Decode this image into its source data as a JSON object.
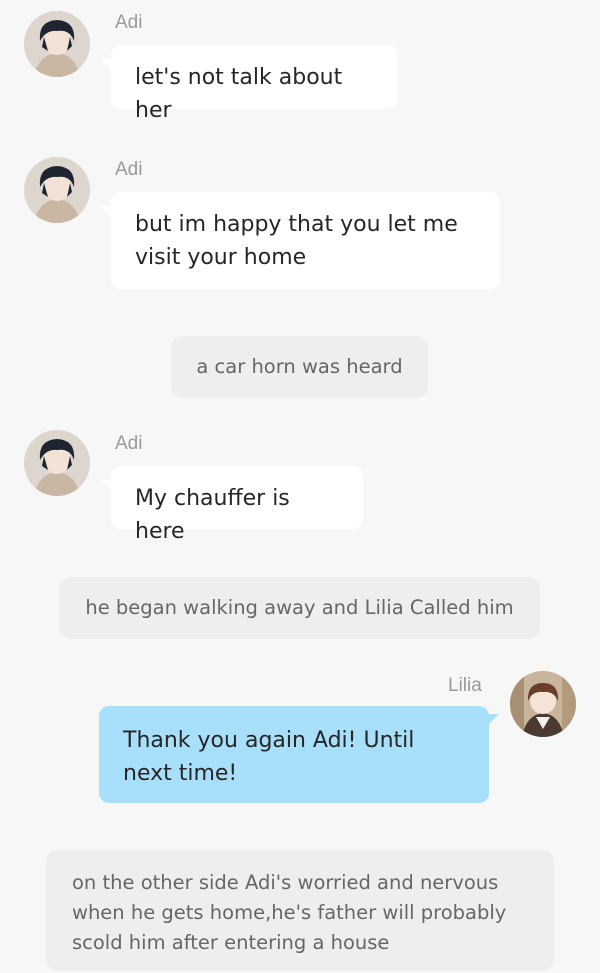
{
  "messages": [
    {
      "type": "left",
      "sender": "Adi",
      "avatar": "adi-avatar",
      "text": "let's not talk about her"
    },
    {
      "type": "left",
      "sender": "Adi",
      "avatar": "adi-avatar",
      "text": "but im happy that you let me visit your home"
    },
    {
      "type": "narration",
      "text": "a car horn was heard"
    },
    {
      "type": "left",
      "sender": "Adi",
      "avatar": "adi-avatar",
      "text": "My chauffer is here"
    },
    {
      "type": "narration",
      "text": "he began walking away  and Lilia Called him"
    },
    {
      "type": "right",
      "sender": "Lilia",
      "avatar": "lilia-avatar",
      "text": "Thank you again Adi! Until next time!"
    },
    {
      "type": "narration",
      "text": "on the other side Adi's worried and nervous when he gets home,he's father will probably scold him after entering a house"
    }
  ]
}
